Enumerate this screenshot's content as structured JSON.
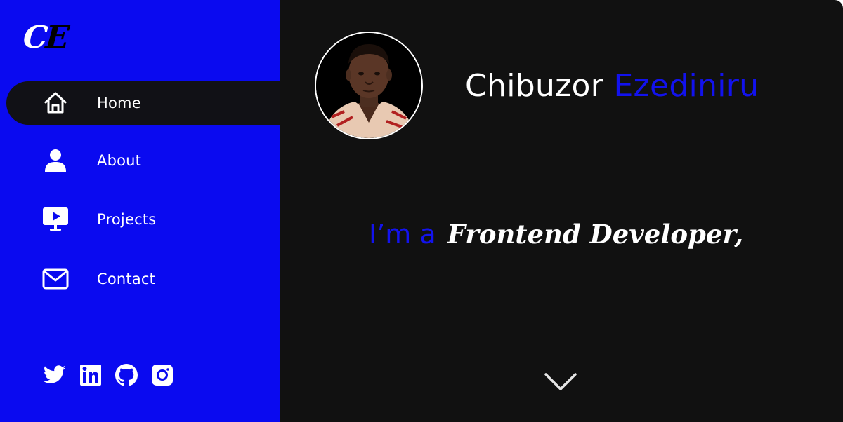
{
  "logo": {
    "first": "C",
    "second": "E"
  },
  "sidebar": {
    "items": [
      {
        "label": "Home",
        "icon": "home-icon",
        "active": true
      },
      {
        "label": "About",
        "icon": "user-icon",
        "active": false
      },
      {
        "label": "Projects",
        "icon": "presentation-icon",
        "active": false
      },
      {
        "label": "Contact",
        "icon": "envelope-icon",
        "active": false
      }
    ],
    "socials": [
      "twitter-icon",
      "linkedin-icon",
      "github-icon",
      "instagram-icon"
    ]
  },
  "hero": {
    "first_name": "Chibuzor",
    "last_name": "Ezediniru",
    "prefix": "I’m a",
    "role": "Frontend Developer,"
  },
  "colors": {
    "sidebar_bg": "#0a0af0",
    "main_bg": "#111111",
    "accent": "#1212ee",
    "active_item_bg": "#111116",
    "text": "#ffffff"
  }
}
